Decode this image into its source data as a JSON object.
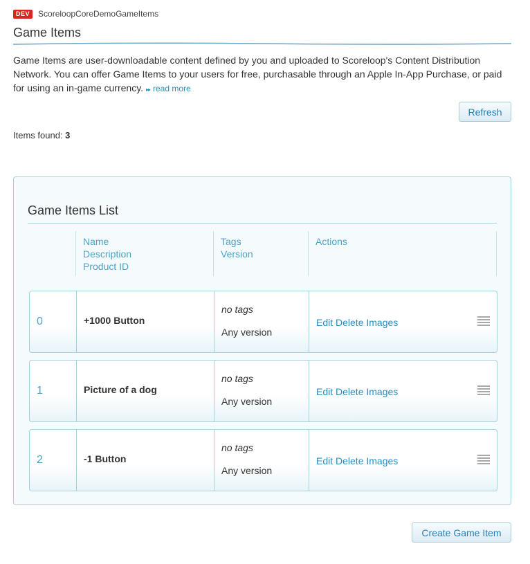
{
  "header": {
    "badge": "DEV",
    "app_name": "ScoreloopCoreDemoGameItems",
    "page_title": "Game Items"
  },
  "intro": {
    "text": "Game Items are user-downloadable content defined by you and uploaded to Scoreloop's Content Distribution Network. You can offer Game Items to your users for free, purchasable through an Apple In-App Purchase, or paid for using an in-game currency.",
    "read_more_icon": "▸▸",
    "read_more": "read more"
  },
  "toolbar": {
    "refresh_label": "Refresh",
    "items_found_label": "Items found:",
    "items_found_count": "3"
  },
  "list": {
    "title": "Game Items List",
    "headers": {
      "name": "Name",
      "description": "Description",
      "product_id": "Product ID",
      "tags": "Tags",
      "version": "Version",
      "actions": "Actions"
    },
    "items": [
      {
        "index": "0",
        "name": "+1000 Button",
        "tags": "no tags",
        "version": "Any version",
        "edit": "Edit",
        "delete": "Delete",
        "images": "Images"
      },
      {
        "index": "1",
        "name": "Picture of a dog",
        "tags": "no tags",
        "version": "Any version",
        "edit": "Edit",
        "delete": "Delete",
        "images": "Images"
      },
      {
        "index": "2",
        "name": "-1 Button",
        "tags": "no tags",
        "version": "Any version",
        "edit": "Edit",
        "delete": "Delete",
        "images": "Images"
      }
    ]
  },
  "footer": {
    "create_label": "Create Game Item"
  },
  "colors": {
    "accent": "#2a8dbd",
    "badge": "#d9261c",
    "border": "#a6cfe0"
  },
  "icons": {
    "drag_handle": "drag-handle-icon",
    "title_underline": "wave-underline"
  }
}
